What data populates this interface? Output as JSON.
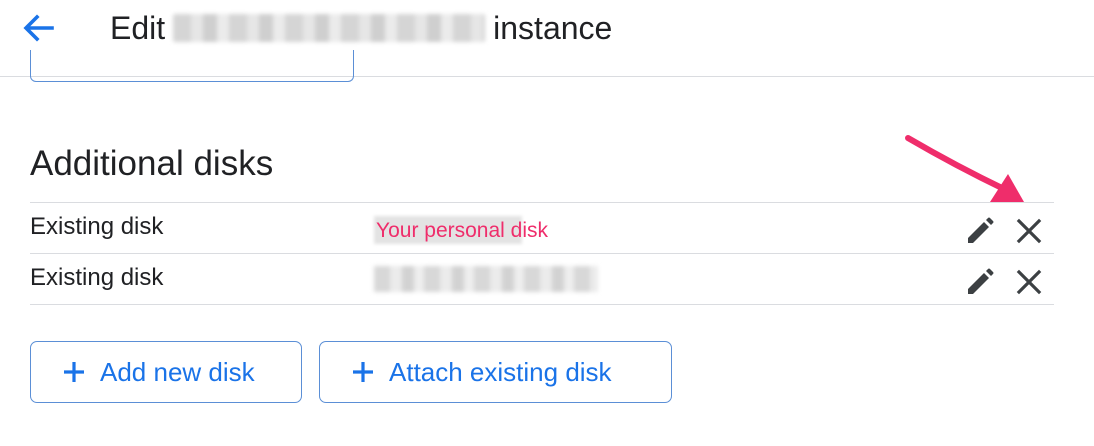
{
  "header": {
    "back_icon": "arrow-back-icon",
    "title_prefix": "Edit",
    "title_suffix": "instance"
  },
  "section": {
    "title": "Additional disks"
  },
  "disks": [
    {
      "type": "Existing disk",
      "name": "Your personal disk",
      "edit_icon": "pencil-icon",
      "remove_icon": "close-icon"
    },
    {
      "type": "Existing disk",
      "name": "",
      "edit_icon": "pencil-icon",
      "remove_icon": "close-icon"
    }
  ],
  "actions": {
    "add_new_disk": "Add new disk",
    "attach_existing_disk": "Attach existing disk"
  },
  "colors": {
    "accent": "#1a73e8",
    "annotation": "#ef2d6b",
    "divider": "#dadce0",
    "text": "#202124"
  }
}
